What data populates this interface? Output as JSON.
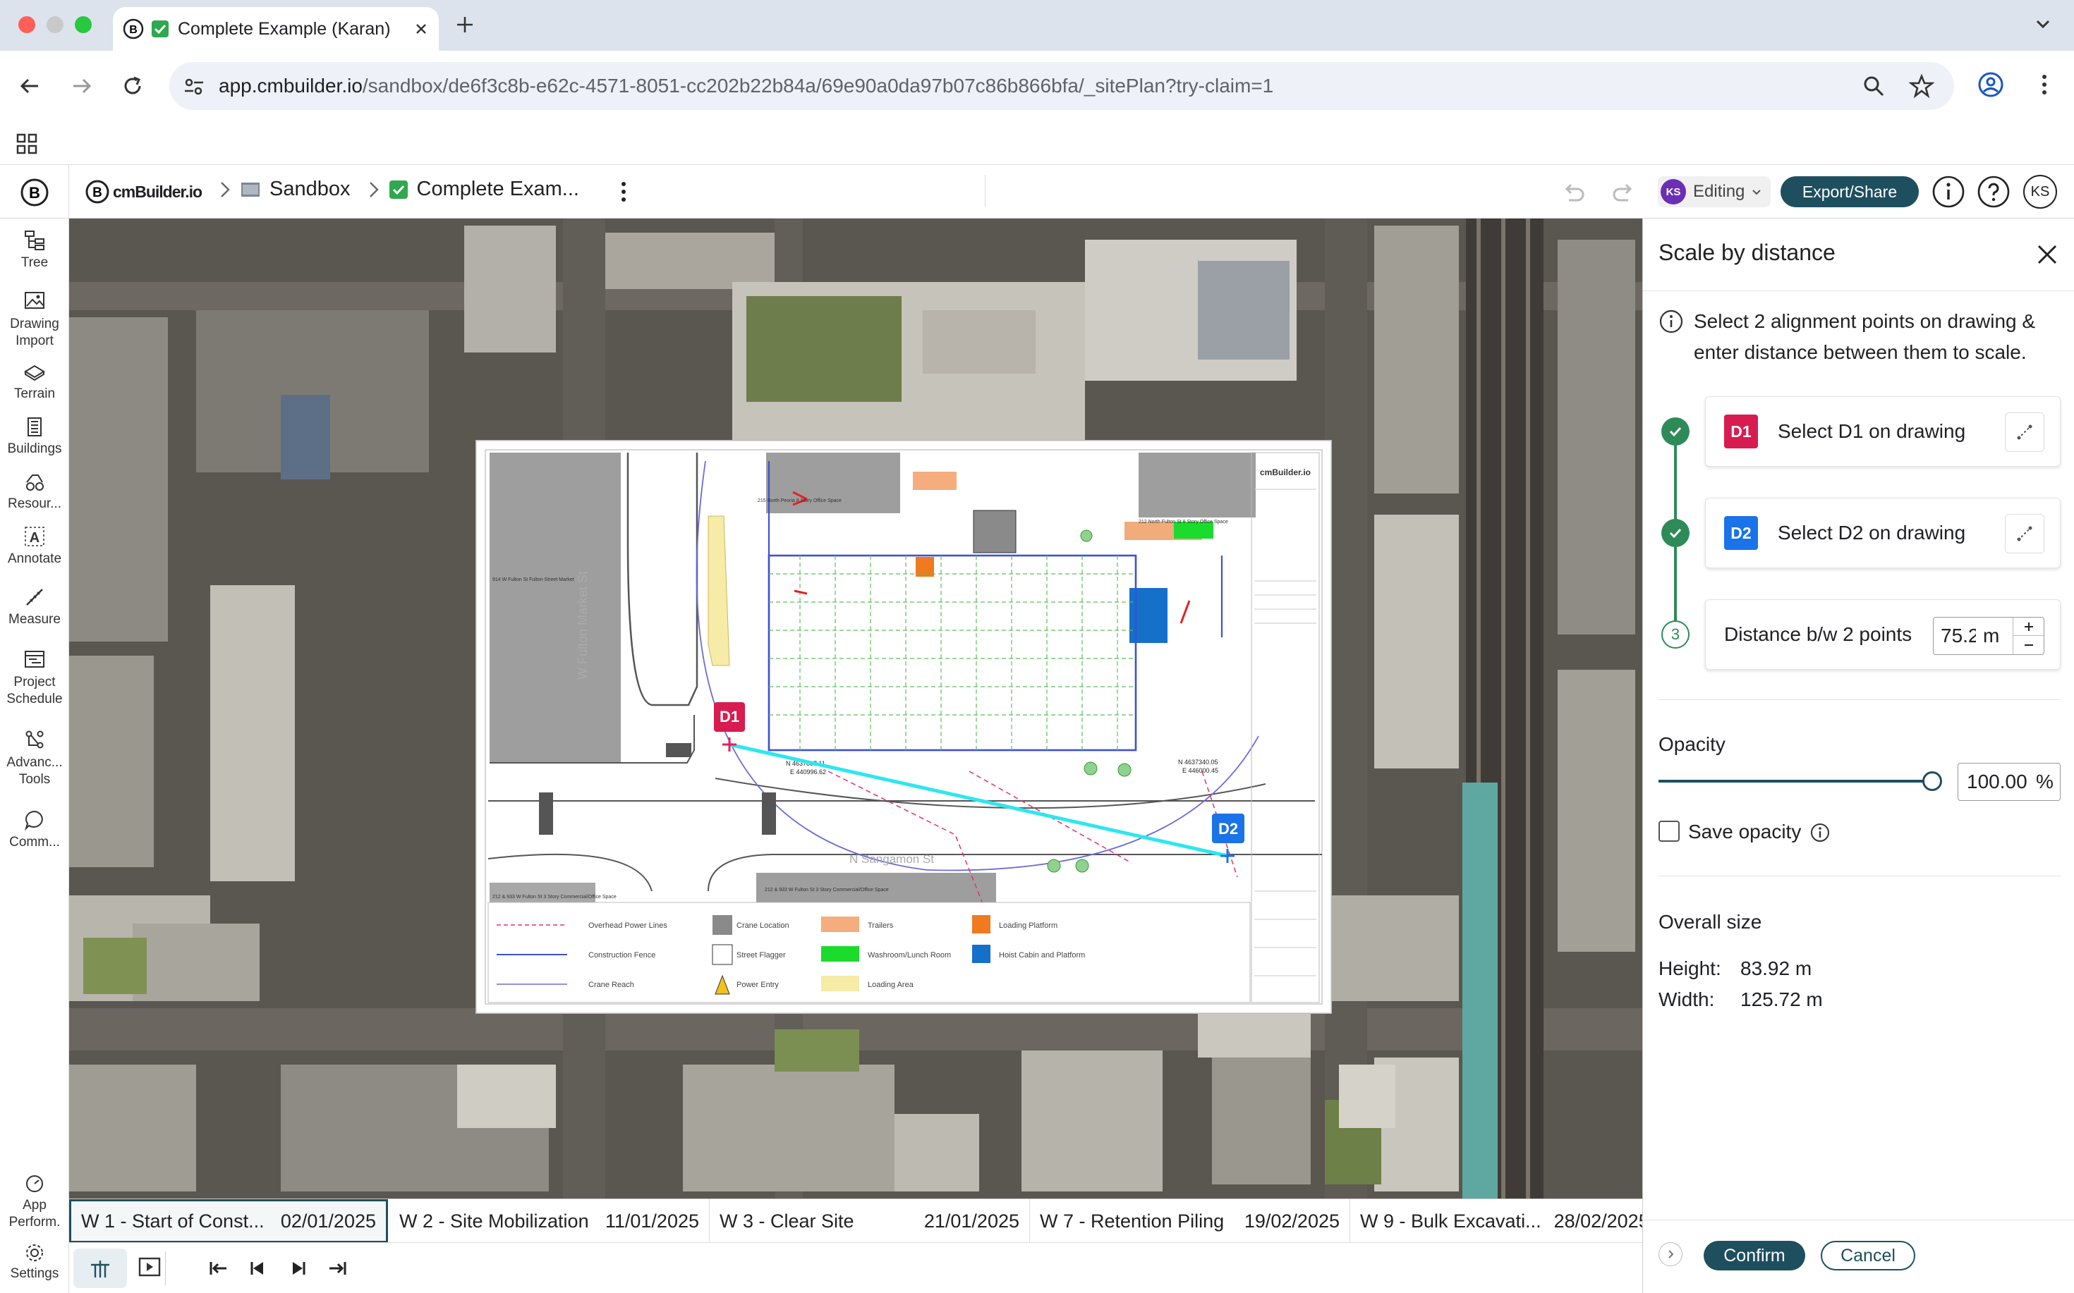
{
  "browser": {
    "tab_title": "Complete Example (Karan)",
    "url_host": "app.cmbuilder.io",
    "url_path": "/sandbox/de6f3c8b-e62c-4571-8051-cc202b22b84a/69e90a0da97b07c86b866bfa/_sitePlan?try-claim=1"
  },
  "app": {
    "logo_text": "cmBuilder.io",
    "breadcrumb": [
      "Sandbox",
      "Complete Exam..."
    ],
    "user_initials": "KS",
    "mode_label": "Editing",
    "export_label": "Export/Share"
  },
  "tools": [
    {
      "label": "Tree",
      "icon": "tree-icon"
    },
    {
      "label": "Drawing Import",
      "icon": "image-icon"
    },
    {
      "label": "Terrain",
      "icon": "terrain-icon"
    },
    {
      "label": "Buildings",
      "icon": "building-icon"
    },
    {
      "label": "Resour...",
      "icon": "resources-icon"
    },
    {
      "label": "Annotate",
      "icon": "annotate-icon"
    },
    {
      "label": "Measure",
      "icon": "measure-icon"
    },
    {
      "label": "Project Schedule",
      "icon": "schedule-icon"
    },
    {
      "label": "Advanc... Tools",
      "icon": "advanced-tools-icon"
    },
    {
      "label": "Comm...",
      "icon": "comment-icon"
    }
  ],
  "bottom_tools": [
    {
      "label": "App Perform.",
      "icon": "performance-icon"
    },
    {
      "label": "Settings",
      "icon": "settings-icon"
    }
  ],
  "drawing": {
    "marker_d1": "D1",
    "marker_d2": "D2",
    "street_1": "W Fulton Market St",
    "street_2": "N Sangamon St",
    "coord_1a": "N 4637897.11",
    "coord_1b": "E 440996.62",
    "coord_2a": "N 4637340.05",
    "coord_2b": "E 446000.45",
    "building_1": "215 North Peoria 8 Story Office Space",
    "building_2": "212 North Fulton St 8 Story Office Space",
    "building_3": "914 W Fulton St Fulton Street Market",
    "building_4": "212 & 933 W Fulton St 3 Story Commercial/Office Space",
    "building_5": "212 & 933 W Fulton St 3 Story Commercial/Office Space",
    "title_block_logo": "cmBuilder.io",
    "legend": [
      [
        "Overhead Power Lines",
        "Crane Location",
        "Trailers",
        "Loading Platform"
      ],
      [
        "Construction Fence",
        "Street Flagger",
        "Washroom/Lunch Room",
        "Hoist Cabin and Platform"
      ],
      [
        "Crane Reach",
        "Power Entry",
        "Loading Area"
      ]
    ]
  },
  "panel": {
    "title": "Scale by distance",
    "info": "Select 2 alignment points on drawing & enter distance between them to scale.",
    "step1": "Select D1 on drawing",
    "step2": "Select D2 on drawing",
    "step3_num": "3",
    "step3": "Distance b/w 2 points",
    "distance_value": "75.2",
    "distance_unit": "m",
    "opacity_label": "Opacity",
    "opacity_value": "100.00",
    "opacity_unit": "%",
    "opacity_fraction": 1.0,
    "save_opacity": "Save opacity",
    "overall_label": "Overall size",
    "height_label": "Height:",
    "height_value": "83.92 m",
    "width_label": "Width:",
    "width_value": "125.72 m",
    "confirm": "Confirm",
    "cancel": "Cancel"
  },
  "timeline": [
    {
      "name": "W 1 - Start of Const...",
      "date": "02/01/2025"
    },
    {
      "name": "W 2 - Site Mobilization",
      "date": "11/01/2025"
    },
    {
      "name": "W 3 - Clear Site",
      "date": "21/01/2025"
    },
    {
      "name": "W 7 - Retention Piling",
      "date": "19/02/2025"
    },
    {
      "name": "W 9 - Bulk Excavati...",
      "date": "28/02/2025"
    }
  ],
  "colors": {
    "accent": "#1e4f5f",
    "d1": "#d81b50",
    "d2": "#1a73e8",
    "check": "#2e8b57",
    "measure_line": "#2ee6f0"
  }
}
